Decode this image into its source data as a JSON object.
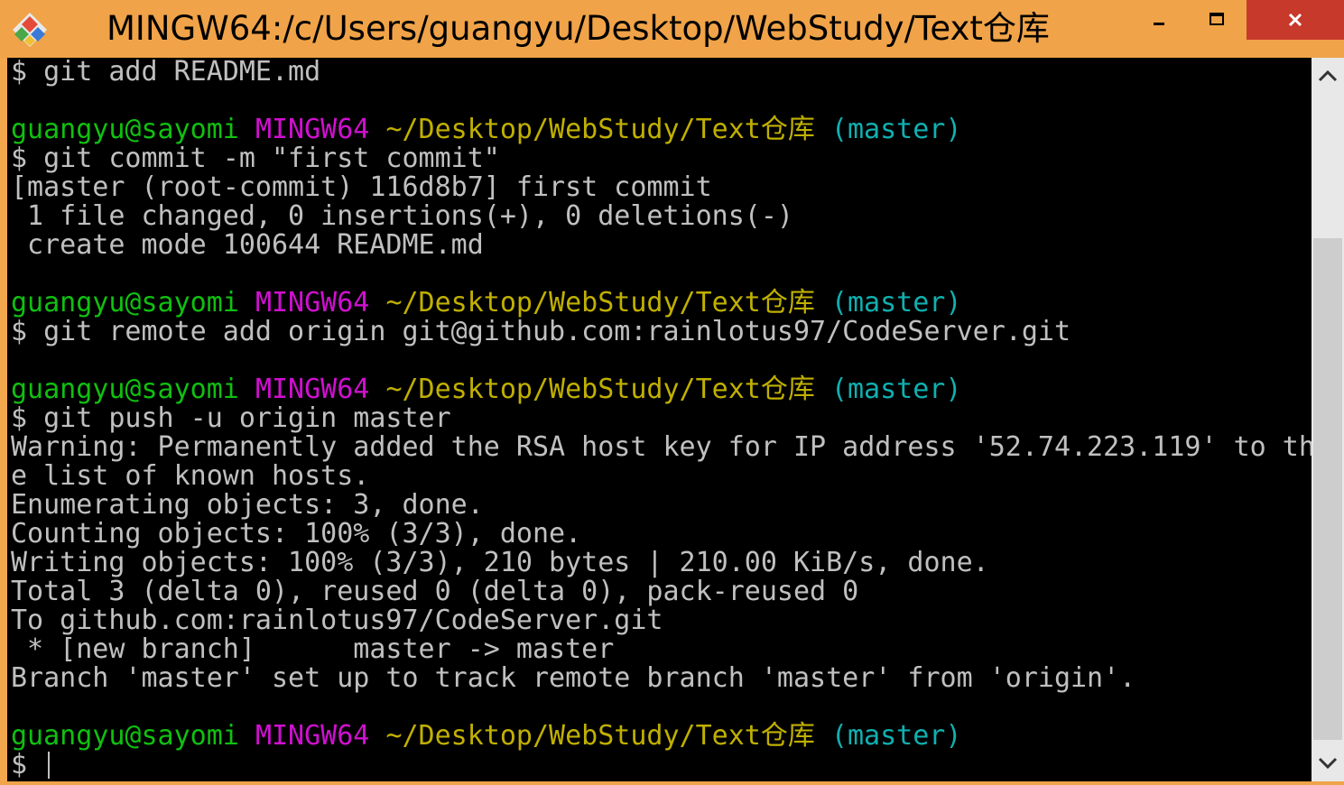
{
  "window": {
    "title": "MINGW64:/c/Users/guangyu/Desktop/WebStudy/Text仓库",
    "accent_color": "#f0a348",
    "close_color": "#c7392b",
    "icon": "git-bash-diamond-icon"
  },
  "controls": {
    "minimize_icon": "minimize-icon",
    "maximize_icon": "maximize-icon",
    "close_icon": "close-icon"
  },
  "terminal": {
    "colors": {
      "background": "#000000",
      "text": "#c0c0c0",
      "user": "#10c010",
      "system": "#d010d0",
      "path": "#c0b000",
      "branch": "#10b0b0"
    },
    "lines": [
      {
        "kind": "text",
        "text": "$ git add README.md"
      },
      {
        "kind": "blank"
      },
      {
        "kind": "prompt",
        "user": "guangyu@sayomi",
        "system": "MINGW64",
        "path": "~/Desktop/WebStudy/Text仓库",
        "branch": "(master)"
      },
      {
        "kind": "text",
        "text": "$ git commit -m \"first commit\""
      },
      {
        "kind": "text",
        "text": "[master (root-commit) 116d8b7] first commit"
      },
      {
        "kind": "text",
        "text": " 1 file changed, 0 insertions(+), 0 deletions(-)"
      },
      {
        "kind": "text",
        "text": " create mode 100644 README.md"
      },
      {
        "kind": "blank"
      },
      {
        "kind": "prompt",
        "user": "guangyu@sayomi",
        "system": "MINGW64",
        "path": "~/Desktop/WebStudy/Text仓库",
        "branch": "(master)"
      },
      {
        "kind": "text",
        "text": "$ git remote add origin git@github.com:rainlotus97/CodeServer.git"
      },
      {
        "kind": "blank"
      },
      {
        "kind": "prompt",
        "user": "guangyu@sayomi",
        "system": "MINGW64",
        "path": "~/Desktop/WebStudy/Text仓库",
        "branch": "(master)"
      },
      {
        "kind": "text",
        "text": "$ git push -u origin master"
      },
      {
        "kind": "text",
        "text": "Warning: Permanently added the RSA host key for IP address '52.74.223.119' to th"
      },
      {
        "kind": "text",
        "text": "e list of known hosts."
      },
      {
        "kind": "text",
        "text": "Enumerating objects: 3, done."
      },
      {
        "kind": "text",
        "text": "Counting objects: 100% (3/3), done."
      },
      {
        "kind": "text",
        "text": "Writing objects: 100% (3/3), 210 bytes | 210.00 KiB/s, done."
      },
      {
        "kind": "text",
        "text": "Total 3 (delta 0), reused 0 (delta 0), pack-reused 0"
      },
      {
        "kind": "text",
        "text": "To github.com:rainlotus97/CodeServer.git"
      },
      {
        "kind": "text",
        "text": " * [new branch]      master -> master"
      },
      {
        "kind": "text",
        "text": "Branch 'master' set up to track remote branch 'master' from 'origin'."
      },
      {
        "kind": "blank"
      },
      {
        "kind": "prompt",
        "user": "guangyu@sayomi",
        "system": "MINGW64",
        "path": "~/Desktop/WebStudy/Text仓库",
        "branch": "(master)"
      },
      {
        "kind": "text",
        "text": "$ "
      }
    ]
  },
  "scrollbar": {
    "up_icon": "scroll-up-arrow-icon",
    "down_icon": "scroll-down-arrow-icon"
  }
}
